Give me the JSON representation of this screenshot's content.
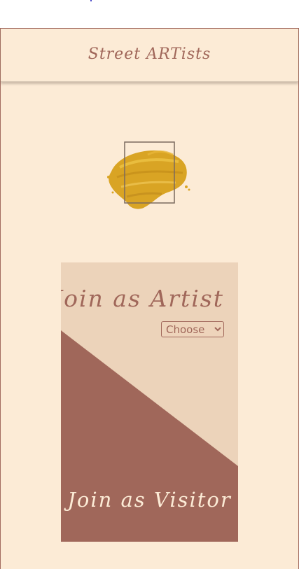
{
  "header": {
    "brand": "Street ARTists"
  },
  "logo": {
    "icon": "paint-brush-stroke-icon",
    "stroke_color": "#d9a424",
    "frame_color": "#7a6a5e"
  },
  "artist_panel": {
    "title": "Join as Artist",
    "select": {
      "selected": "Choose",
      "options": [
        "Choose"
      ]
    }
  },
  "visitor_panel": {
    "title": "Join as Visitor"
  },
  "colors": {
    "background": "#fcebd6",
    "accent": "#a0675a",
    "artist_panel": "#ecd3ba",
    "visitor_panel": "#a0675a"
  }
}
